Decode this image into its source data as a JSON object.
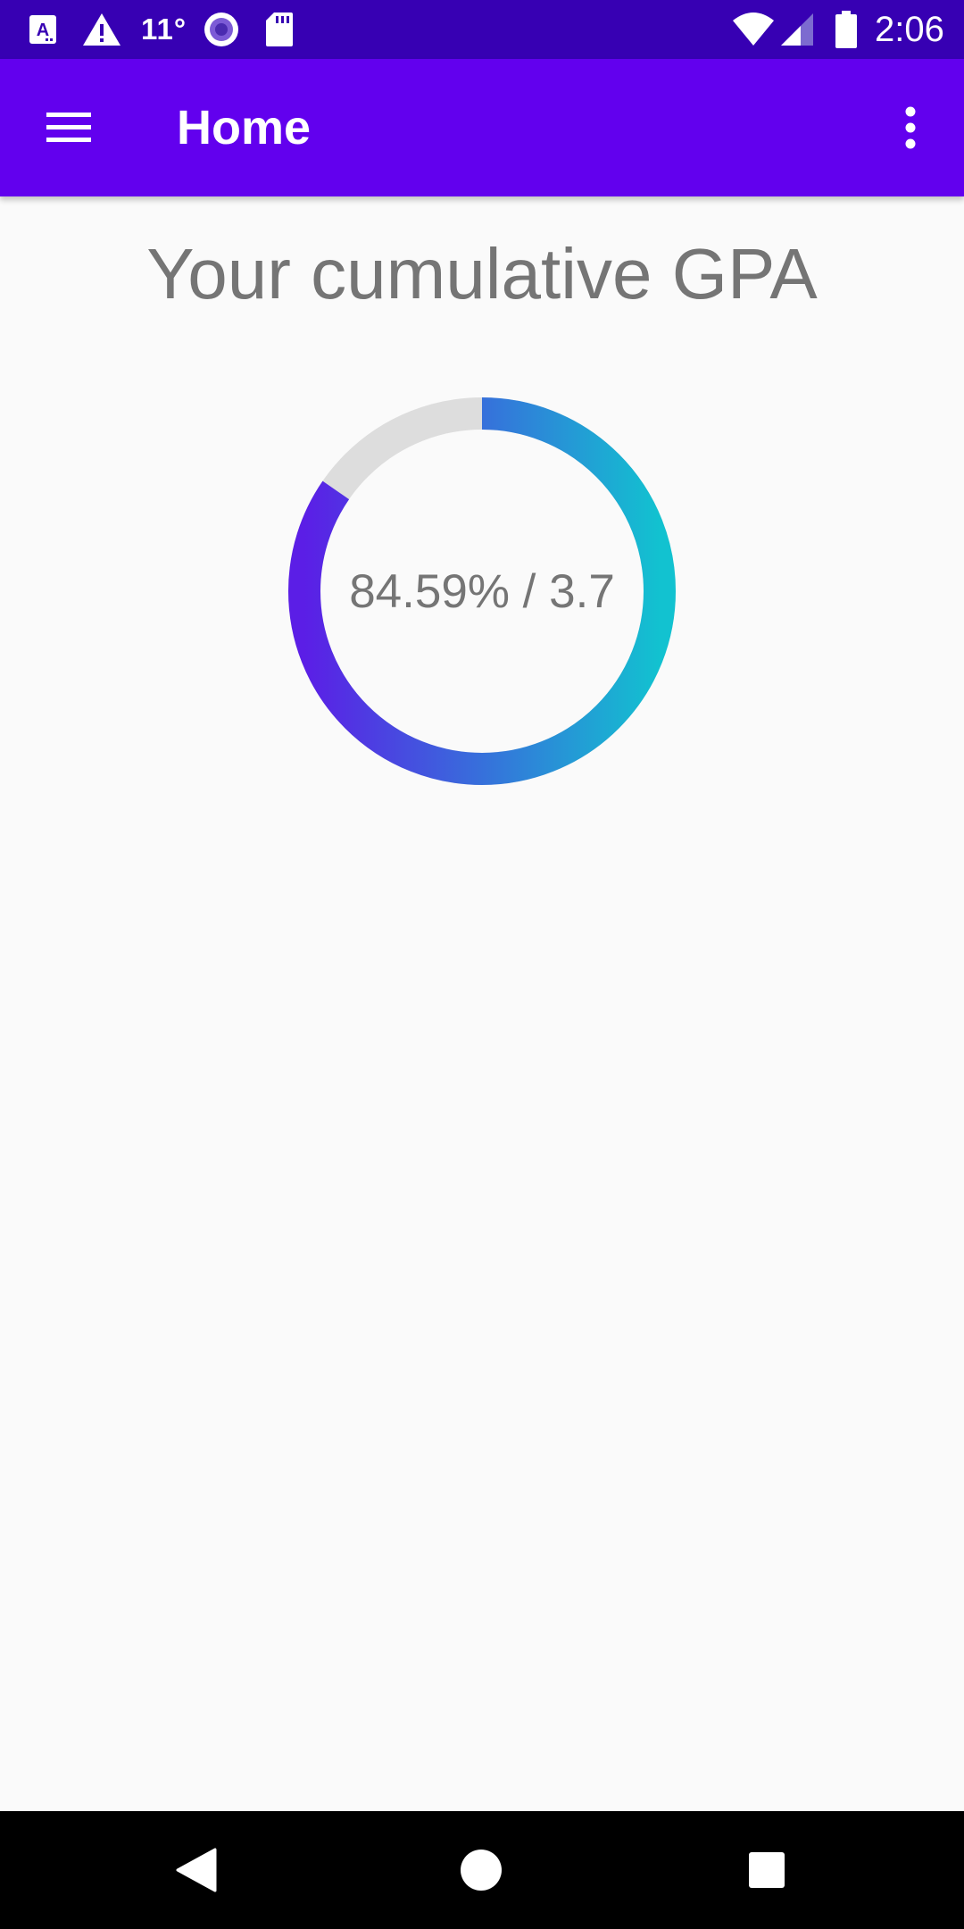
{
  "status_bar": {
    "temperature": "11°",
    "time": "2:06",
    "icons": [
      "text-notification-icon",
      "warning-icon",
      "weather-temp",
      "circle-app-icon",
      "sd-card-icon",
      "wifi-icon",
      "cell-signal-icon",
      "battery-icon"
    ]
  },
  "app_bar": {
    "title": "Home",
    "menu_icon": "hamburger-menu-icon",
    "overflow_icon": "more-vert-icon"
  },
  "main": {
    "heading": "Your cumulative GPA",
    "gpa_text": "84.59% / 3.7",
    "progress_percent": 84.59,
    "gradient_start": "#5b1ee6",
    "gradient_end": "#12c2d0",
    "track_color": "#dddddd"
  },
  "nav_bar": {
    "back_icon": "back-triangle-icon",
    "home_icon": "home-circle-icon",
    "recents_icon": "recents-square-icon"
  },
  "colors": {
    "status_bar": "#3700b3",
    "app_bar": "#6200ee",
    "background": "#fafafa",
    "text_gray": "#757575"
  }
}
